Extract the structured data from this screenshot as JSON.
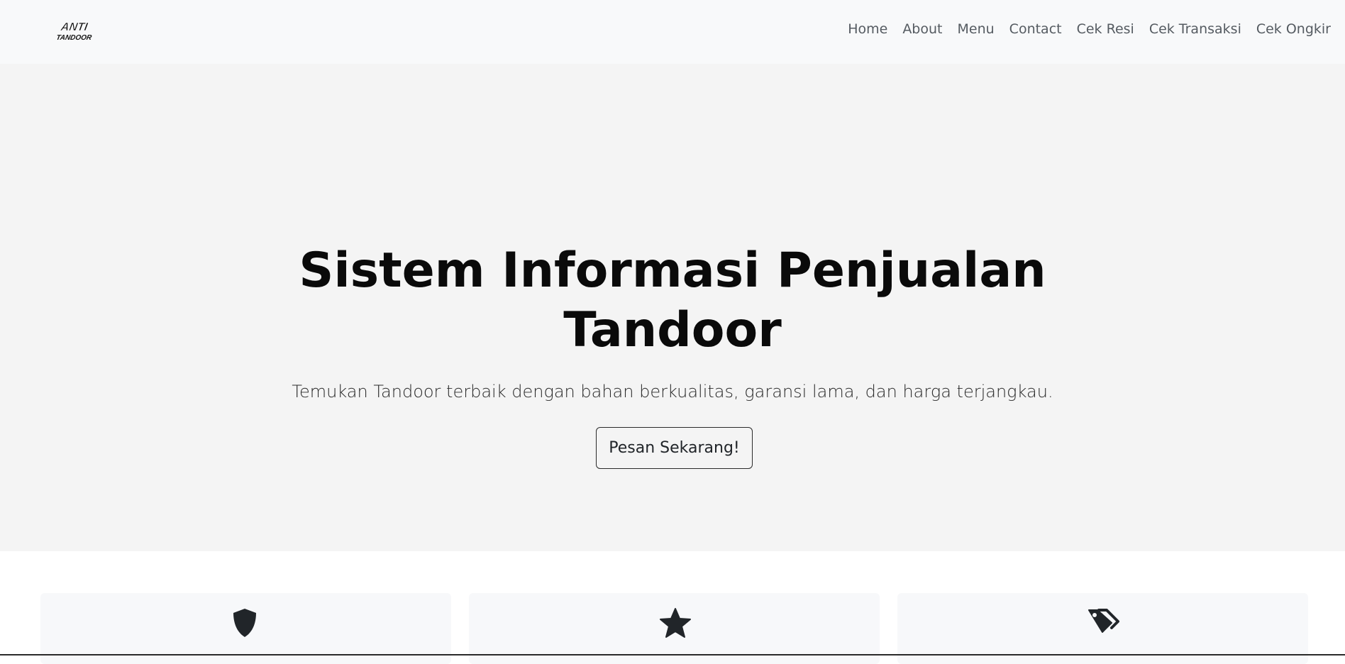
{
  "brand": {
    "logo_text_top": "ANTI",
    "logo_text_bottom": "TANDOOR"
  },
  "nav": {
    "items": [
      {
        "label": "Home"
      },
      {
        "label": "About"
      },
      {
        "label": "Menu"
      },
      {
        "label": "Contact"
      },
      {
        "label": "Cek Resi"
      },
      {
        "label": "Cek Transaksi"
      },
      {
        "label": "Cek Ongkir"
      }
    ]
  },
  "hero": {
    "title_line1": "Sistem Informasi Penjualan",
    "title_line2": "Tandoor",
    "subtitle": "Temukan Tandoor terbaik dengan bahan berkualitas, garansi lama, dan harga terjangkau.",
    "cta_label": "Pesan Sekarang!"
  },
  "features": [
    {
      "icon": "shield-icon"
    },
    {
      "icon": "star-icon"
    },
    {
      "icon": "tags-icon"
    }
  ],
  "colors": {
    "navbar_bg": "#f8f9fa",
    "hero_bg": "#f4f4f4",
    "card_bg": "#f7f8fa",
    "icon": "#212529",
    "nav_text": "#555b61"
  }
}
